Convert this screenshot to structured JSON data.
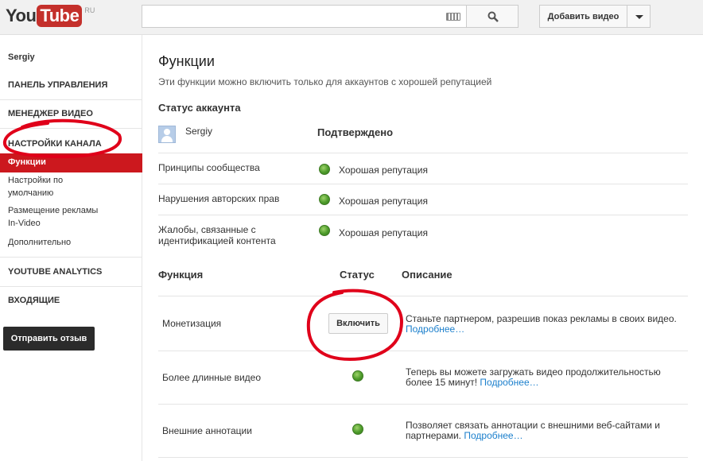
{
  "header": {
    "logo_you": "You",
    "logo_tube": "Tube",
    "logo_region": "RU",
    "search_value": "",
    "upload_label": "Добавить видео"
  },
  "sidebar": {
    "user": "Sergiy",
    "dashboard": "ПАНЕЛЬ УПРАВЛЕНИЯ",
    "video_manager": "МЕНЕДЖЕР ВИДЕО",
    "channel_settings": "НАСТРОЙКИ КАНАЛА",
    "items": [
      {
        "label": "Функции",
        "active": true
      },
      {
        "label": "Настройки по"
      },
      {
        "label": "умолчанию"
      },
      {
        "label": "Размещение рекламы"
      },
      {
        "label": "In-Video"
      },
      {
        "label": "Дополнительно"
      }
    ],
    "analytics": "YOUTUBE ANALYTICS",
    "inbox": "ВХОДЯЩИЕ",
    "feedback": "Отправить отзыв"
  },
  "main": {
    "title": "Функции",
    "subtitle": "Эти функции можно включить только для аккаунтов с хорошей репутацией",
    "account_status_heading": "Статус аккаунта",
    "account_user": "Sergiy",
    "account_verified": "Подтверждено",
    "status_rows": [
      {
        "label": "Принципы сообщества",
        "status": "Хорошая репутация"
      },
      {
        "label": "Нарушения авторских прав",
        "status": "Хорошая репутация"
      },
      {
        "label": "Жалобы, связанные с",
        "label2": "идентификацией контента",
        "status": "Хорошая репутация"
      }
    ],
    "features_header": {
      "col1": "Функция",
      "col2": "Статус",
      "col3": "Описание"
    },
    "features": [
      {
        "name": "Монетизация",
        "button": "Включить",
        "desc": "Станьте партнером, разрешив показ рекламы в своих видео.",
        "link": "Подробнее…"
      },
      {
        "name": "Более длинные видео",
        "desc": "Теперь вы можете загружать видео продолжительностью более 15 минут!",
        "link": "Подробнее…"
      },
      {
        "name": "Внешние аннотации",
        "desc": "Позволяет связать аннотации с внешними веб-сайтами и партнерами.",
        "link": "Подробнее…"
      }
    ]
  },
  "colors": {
    "accent": "#cc181e",
    "link": "#1b7fcc",
    "annotation": "#e0001a"
  }
}
